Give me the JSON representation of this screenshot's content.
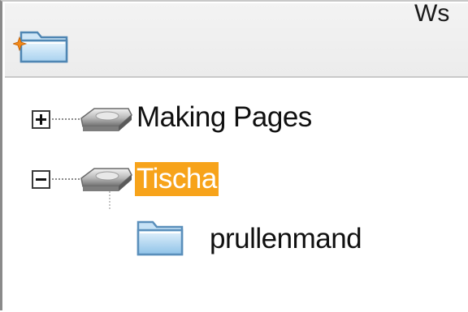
{
  "toolbar": {
    "new_folder_icon": "new-folder-icon",
    "corner_glyph": "Ws"
  },
  "tree": {
    "items": [
      {
        "label": "Making Pages",
        "expander": "plus",
        "icon": "drive-icon",
        "selected": false
      },
      {
        "label": "Tischa",
        "expander": "minus",
        "icon": "drive-icon",
        "selected": true
      },
      {
        "label": "prullenmand",
        "icon": "folder-icon",
        "selected": false
      }
    ]
  },
  "colors": {
    "selection": "#f7a31a",
    "text": "#101010",
    "folder_blue": "#8fc3e8"
  }
}
